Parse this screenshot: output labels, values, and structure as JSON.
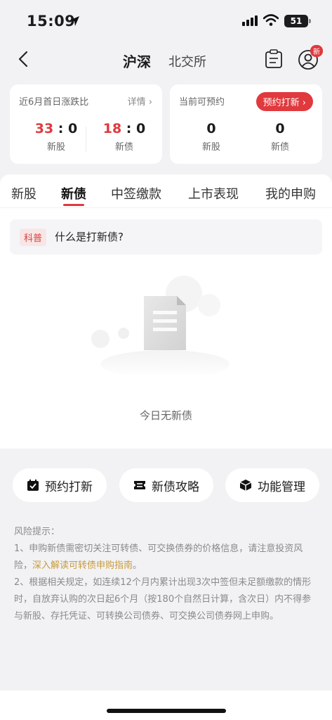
{
  "status_bar": {
    "time": "15:09",
    "battery": "51"
  },
  "nav": {
    "tab_active": "沪深",
    "tab_other": "北交所",
    "badge": "新"
  },
  "card_left": {
    "title": "近6月首日涨跌比",
    "link": "详情",
    "stats": [
      {
        "up": "33",
        "sep": ":",
        "down": "0",
        "label": "新股"
      },
      {
        "up": "18",
        "sep": ":",
        "down": "0",
        "label": "新债"
      }
    ]
  },
  "card_right": {
    "title": "当前可预约",
    "button": "预约打新",
    "stats": [
      {
        "value": "0",
        "label": "新股"
      },
      {
        "value": "0",
        "label": "新债"
      }
    ]
  },
  "tabs": [
    "新股",
    "新债",
    "中签缴款",
    "上市表现",
    "我的申购"
  ],
  "active_tab": "新债",
  "kepu": {
    "tag": "科普",
    "text": "什么是打新债?"
  },
  "empty_text": "今日无新债",
  "shortcuts": [
    "预约打新",
    "新债攻略",
    "功能管理"
  ],
  "risk": {
    "title": "风险提示：",
    "p1_a": "1、申购新债需密切关注可转债、可交换债券的价格信息，请注意投资风险，",
    "p1_link": "深入解读可转债申购指南",
    "p1_b": "。",
    "p2": "2、根据相关规定，如连续12个月内累计出现3次中签但未足额缴款的情形时，自放弃认购的次日起6个月（按180个自然日计算，含次日）内不得参与新股、存托凭证、可转换公司债券、可交换公司债券网上申购。"
  },
  "colors": {
    "accent": "#e0393e",
    "link": "#c89a3a"
  }
}
